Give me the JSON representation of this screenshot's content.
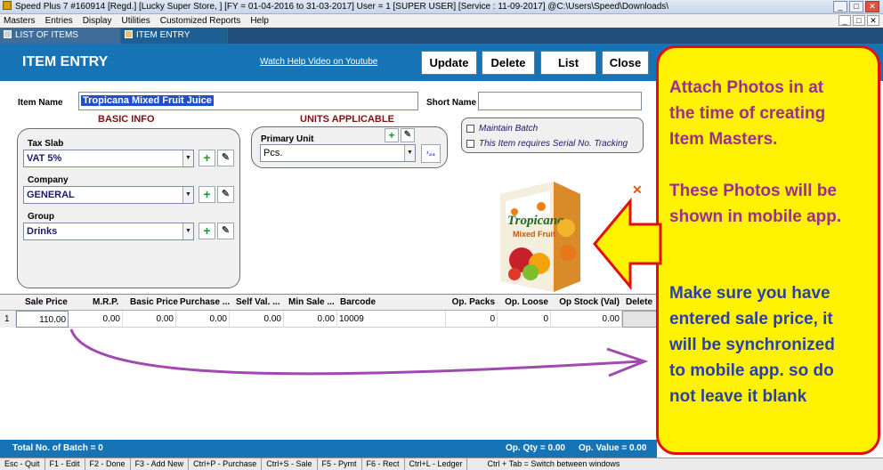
{
  "window": {
    "title": "Speed Plus 7 #160914  [Regd.]  [Lucky Super Store, ] [FY = 01-04-2016 to 31-03-2017] User = 1 [SUPER USER]  [Service : 11-09-2017]  @C:\\Users\\Speed\\Downloads\\",
    "minimize": "_",
    "maximize": "□",
    "close": "✕"
  },
  "menu": [
    "Masters",
    "Entries",
    "Display",
    "Utilities",
    "Customized Reports",
    "Help"
  ],
  "tabs": [
    {
      "label": "LIST OF ITEMS"
    },
    {
      "label": "ITEM ENTRY"
    }
  ],
  "header": {
    "title": "ITEM ENTRY",
    "help_link": "Watch Help Video on Youtube",
    "buttons": {
      "update": "Update",
      "delete": "Delete",
      "list": "List",
      "close": "Close"
    }
  },
  "form": {
    "item_name_label": "Item Name",
    "item_name_value": "Tropicana Mixed Fruit Juice",
    "short_name_label": "Short Name",
    "short_name_value": "",
    "basic_info_title": "BASIC INFO",
    "units_title": "UNITS APPLICABLE",
    "tax_slab_label": "Tax Slab",
    "tax_slab_value": "VAT 5%",
    "company_label": "Company",
    "company_value": "GENERAL",
    "group_label": "Group",
    "group_value": "Drinks",
    "primary_unit_label": "Primary Unit",
    "primary_unit_value": "Pcs.",
    "unit_button": "¹₂₃",
    "maintain_batch": "Maintain Batch",
    "serial_tracking": "This Item requires Serial No. Tracking",
    "photo_remove": "✕"
  },
  "product_image": {
    "brand": "Tropicana",
    "sub": "Mixed Fruit"
  },
  "grid": {
    "headers": [
      "Sale Price",
      "M.R.P.",
      "Basic Price",
      "Purchase ...",
      "Self Val. ...",
      "Min Sale ...",
      "Barcode",
      "Op. Packs",
      "Op. Loose",
      "Op Stock (Val)",
      "Delete"
    ],
    "row": {
      "num": "1",
      "sale_price": "110.00",
      "mrp": "0.00",
      "basic_price": "0.00",
      "purchase": "0.00",
      "self_val": "0.00",
      "min_sale": "0.00",
      "barcode": "10009",
      "op_packs": "0",
      "op_loose": "0",
      "op_stock": "0.00"
    }
  },
  "footer": {
    "total_batch": "Total No. of Batch = 0",
    "op_qty": "Op. Qty = 0.00",
    "op_value": "Op. Value = 0.00"
  },
  "statusbar": [
    "Esc - Quit",
    "F1 - Edit",
    "F2 - Done",
    "F3 - Add New",
    "Ctrl+P - Purchase",
    "Ctrl+S - Sale",
    "F5 - Pymt",
    "F6 - Rect",
    "Ctrl+L - Ledger",
    "Ctrl + Tab = Switch between windows"
  ],
  "callout": {
    "line1": "Attach Photos in at",
    "line2": "the time of creating",
    "line3": "Item Masters.",
    "line4": "These Photos will be",
    "line5": "shown in mobile app.",
    "line6": "Make sure you have",
    "line7": "entered sale price, it",
    "line8": "will be synchronized",
    "line9": "to mobile app. so do",
    "line10": "not leave it blank",
    "color_top": "#9b2e8e",
    "color_bottom": "#2a3fa8"
  },
  "colors": {
    "header_blue": "#1674b6",
    "section_red": "#7d1010",
    "callout_yellow": "#fff200",
    "callout_border": "#e01010",
    "arrow_purple": "#a04ab0"
  }
}
